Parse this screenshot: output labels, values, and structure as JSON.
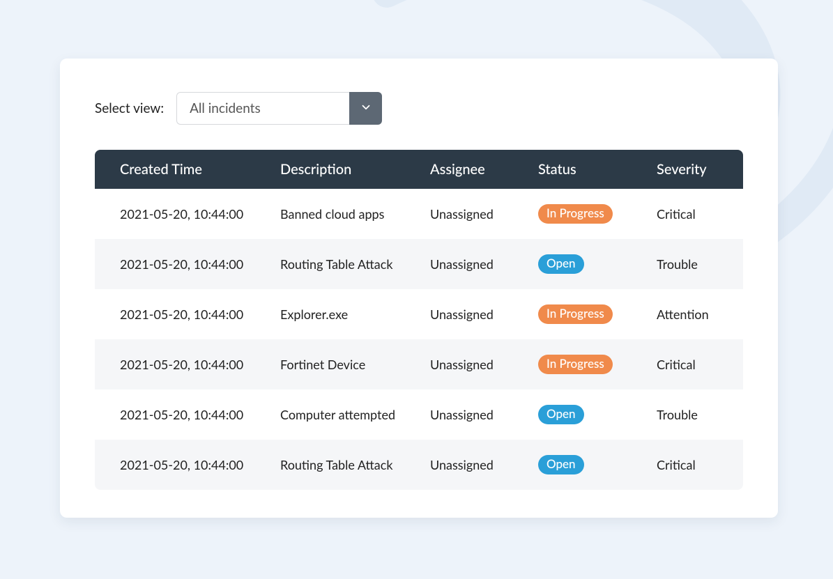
{
  "view": {
    "label": "Select view:",
    "selected": "All incidents"
  },
  "table": {
    "headers": {
      "created": "Created Time",
      "description": "Description",
      "assignee": "Assignee",
      "status": "Status",
      "severity": "Severity"
    },
    "rows": [
      {
        "created": "2021-05-20, 10:44:00",
        "description": "Banned cloud apps",
        "assignee": "Unassigned",
        "status": "In Progress",
        "status_type": "progress",
        "severity": "Critical"
      },
      {
        "created": "2021-05-20, 10:44:00",
        "description": "Routing Table Attack",
        "assignee": "Unassigned",
        "status": "Open",
        "status_type": "open",
        "severity": "Trouble"
      },
      {
        "created": "2021-05-20, 10:44:00",
        "description": "Explorer.exe",
        "assignee": "Unassigned",
        "status": "In Progress",
        "status_type": "progress",
        "severity": "Attention"
      },
      {
        "created": "2021-05-20, 10:44:00",
        "description": "Fortinet Device",
        "assignee": "Unassigned",
        "status": "In Progress",
        "status_type": "progress",
        "severity": "Critical"
      },
      {
        "created": "2021-05-20, 10:44:00",
        "description": "Computer attempted",
        "assignee": "Unassigned",
        "status": "Open",
        "status_type": "open",
        "severity": "Trouble"
      },
      {
        "created": "2021-05-20, 10:44:00",
        "description": "Routing Table Attack",
        "assignee": "Unassigned",
        "status": "Open",
        "status_type": "open",
        "severity": "Critical"
      }
    ]
  },
  "status_colors": {
    "progress": "#f08a4b",
    "open": "#2a9fd8"
  }
}
